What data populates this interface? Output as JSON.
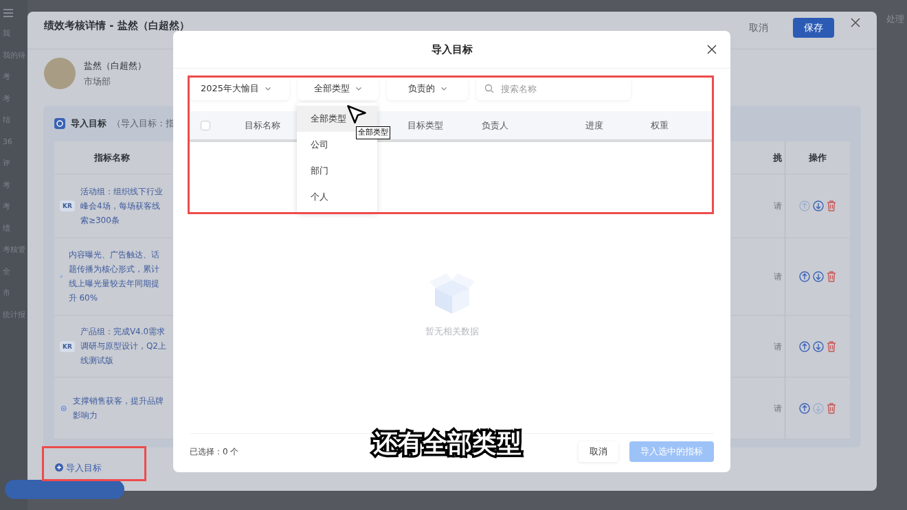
{
  "sidebar": {
    "items": [
      "我",
      "我的待",
      "考",
      "考",
      "结",
      "36",
      "评",
      "考",
      "考",
      "绩",
      "考核管",
      "全",
      "市",
      "统计报"
    ]
  },
  "top_right": {
    "label": "处理"
  },
  "drawer": {
    "title": "绩效考核详情 - 盐然（白超然）",
    "buttons": {
      "cancel": "取消",
      "save": "保存"
    },
    "profile": {
      "name": "盐然（白超然）",
      "department": "市场部"
    },
    "section": {
      "title": "导入目标",
      "note": "（导入目标：指"
    },
    "table": {
      "columns": [
        "指标名称",
        "挑",
        "操作"
      ],
      "rows": [
        {
          "kind": "kr",
          "badge": "KR",
          "name": "活动组：组织线下行业峰会4场，每场获客线索≥300条",
          "column_3": "请",
          "up_disabled": true,
          "down_disabled": false
        },
        {
          "kind": "goal",
          "name": "内容曝光、广告触达、话题传播为核心形式，累计线上曝光量较去年同期提升 60%",
          "column_3": "请",
          "up_disabled": false,
          "down_disabled": false
        },
        {
          "kind": "kr",
          "badge": "KR",
          "name": "产品组：完成V4.0需求调研与原型设计，Q2上线测试版",
          "column_3": "请",
          "up_disabled": false,
          "down_disabled": false
        },
        {
          "kind": "goal",
          "name": "支撑销售获客，提升品牌影响力",
          "column_3": "请",
          "up_disabled": false,
          "down_disabled": true
        }
      ]
    },
    "import_link": "导入目标"
  },
  "modal": {
    "title": "导入目标",
    "filters": [
      {
        "label": "2025年大愉目"
      },
      {
        "label": "全部类型"
      },
      {
        "label": "负责的"
      }
    ],
    "search": {
      "placeholder": "搜索名称"
    },
    "dropdown": {
      "options": [
        {
          "label": "全部类型",
          "selected": true
        },
        {
          "label": "公司",
          "selected": false
        },
        {
          "label": "部门",
          "selected": false
        },
        {
          "label": "个人",
          "selected": false
        }
      ]
    },
    "tooltip": "全部类型",
    "table": {
      "select_all_checked": false,
      "columns": [
        "目标名称",
        "目标类型",
        "负责人",
        "进度",
        "权重"
      ]
    },
    "empty_text": "暂无相关数据",
    "footer": {
      "selected": "已选择：0 个",
      "cancel": "取消",
      "import": "导入选中的指标",
      "import_disabled": true
    }
  },
  "subtitle": "还有全部类型"
}
